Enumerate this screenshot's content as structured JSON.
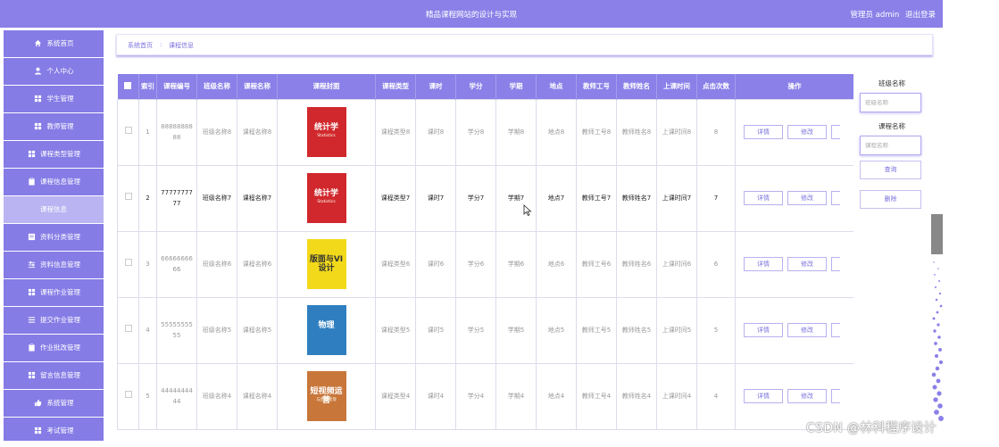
{
  "header": {
    "title": "精品课程网站的设计与实现",
    "user": "管理员 admin",
    "logout": "退出登录"
  },
  "sidebar": [
    {
      "label": "系统首页",
      "icon": "home-icon",
      "sub": false
    },
    {
      "label": "个人中心",
      "icon": "user-icon",
      "sub": false
    },
    {
      "label": "学生管理",
      "icon": "grid-icon",
      "sub": false
    },
    {
      "label": "教师管理",
      "icon": "grid-icon",
      "sub": false
    },
    {
      "label": "课程类型管理",
      "icon": "grid-icon",
      "sub": false
    },
    {
      "label": "课程信息管理",
      "icon": "clipboard-icon",
      "sub": false
    },
    {
      "label": "课程信息",
      "icon": "",
      "sub": true
    },
    {
      "label": "资料分类管理",
      "icon": "doc-icon",
      "sub": false
    },
    {
      "label": "资料信息管理",
      "icon": "sliders-icon",
      "sub": false
    },
    {
      "label": "课程作业管理",
      "icon": "grid-icon",
      "sub": false
    },
    {
      "label": "提交作业管理",
      "icon": "list-icon",
      "sub": false
    },
    {
      "label": "作业批改管理",
      "icon": "clipboard-icon",
      "sub": false
    },
    {
      "label": "留言信息管理",
      "icon": "grid-icon",
      "sub": false
    },
    {
      "label": "系统管理",
      "icon": "thumb-icon",
      "sub": false
    },
    {
      "label": "考试管理",
      "icon": "grid-icon",
      "sub": false
    }
  ],
  "breadcrumb": {
    "home": "系统首页",
    "sep": ":",
    "current": "课程信息"
  },
  "table": {
    "headers": [
      "索引",
      "课程编号",
      "班级名称",
      "课程名称",
      "课程封面",
      "课程类型",
      "课时",
      "学分",
      "学期",
      "地点",
      "教师工号",
      "教师姓名",
      "上课时间",
      "点击次数",
      "操作"
    ],
    "detail_label": "详情",
    "edit_label": "修改",
    "rows": [
      {
        "index": "1",
        "code": "8888888888",
        "class": "班级名称8",
        "name": "课程名称8",
        "cover_title": "统计学",
        "cover_sub": "Statistics",
        "cover_color": "#d0282d",
        "type": "课程类型8",
        "hours": "课时8",
        "credit": "学分8",
        "term": "学期8",
        "place": "地点8",
        "tno": "教师工号8",
        "tname": "教师姓名8",
        "time": "上课时间8",
        "clicks": "8",
        "active": false
      },
      {
        "index": "2",
        "code": "7777777777",
        "class": "班级名称7",
        "name": "课程名称7",
        "cover_title": "统计学",
        "cover_sub": "Statistics",
        "cover_color": "#d0282d",
        "type": "课程类型7",
        "hours": "课时7",
        "credit": "学分7",
        "term": "学期7",
        "place": "地点7",
        "tno": "教师工号7",
        "tname": "教师姓名7",
        "time": "上课时间7",
        "clicks": "7",
        "active": true
      },
      {
        "index": "3",
        "code": "6666666666",
        "class": "班级名称6",
        "name": "课程名称6",
        "cover_title": "版面与VI设计",
        "cover_sub": "",
        "cover_color": "#f2d91a",
        "type": "课程类型6",
        "hours": "课时6",
        "credit": "学分6",
        "term": "学期6",
        "place": "地点6",
        "tno": "教师工号6",
        "tname": "教师姓名6",
        "time": "上课时间6",
        "clicks": "6",
        "active": false
      },
      {
        "index": "4",
        "code": "5555555555",
        "class": "班级名称5",
        "name": "课程名称5",
        "cover_title": "物理",
        "cover_sub": "",
        "cover_color": "#2f7fc0",
        "type": "课程类型5",
        "hours": "课时5",
        "credit": "学分5",
        "term": "学期5",
        "place": "地点5",
        "tno": "教师工号5",
        "tname": "教师姓名5",
        "time": "上课时间5",
        "clicks": "5",
        "active": false
      },
      {
        "index": "5",
        "code": "4444444444",
        "class": "班级名称4",
        "name": "课程名称4",
        "cover_title": "短视频运营",
        "cover_sub": "与直播变现",
        "cover_color": "#c8763a",
        "type": "课程类型4",
        "hours": "课时4",
        "credit": "学分4",
        "term": "学期4",
        "place": "地点4",
        "tno": "教师工号4",
        "tname": "教师姓名4",
        "time": "上课时间4",
        "clicks": "4",
        "active": false
      }
    ]
  },
  "search": {
    "class_label": "班级名称",
    "class_placeholder": "班级名称",
    "course_label": "课程名称",
    "course_placeholder": "课程名称",
    "query_button": "查询",
    "delete_button": "删除"
  },
  "watermark": "CSDN @林科程序设计"
}
